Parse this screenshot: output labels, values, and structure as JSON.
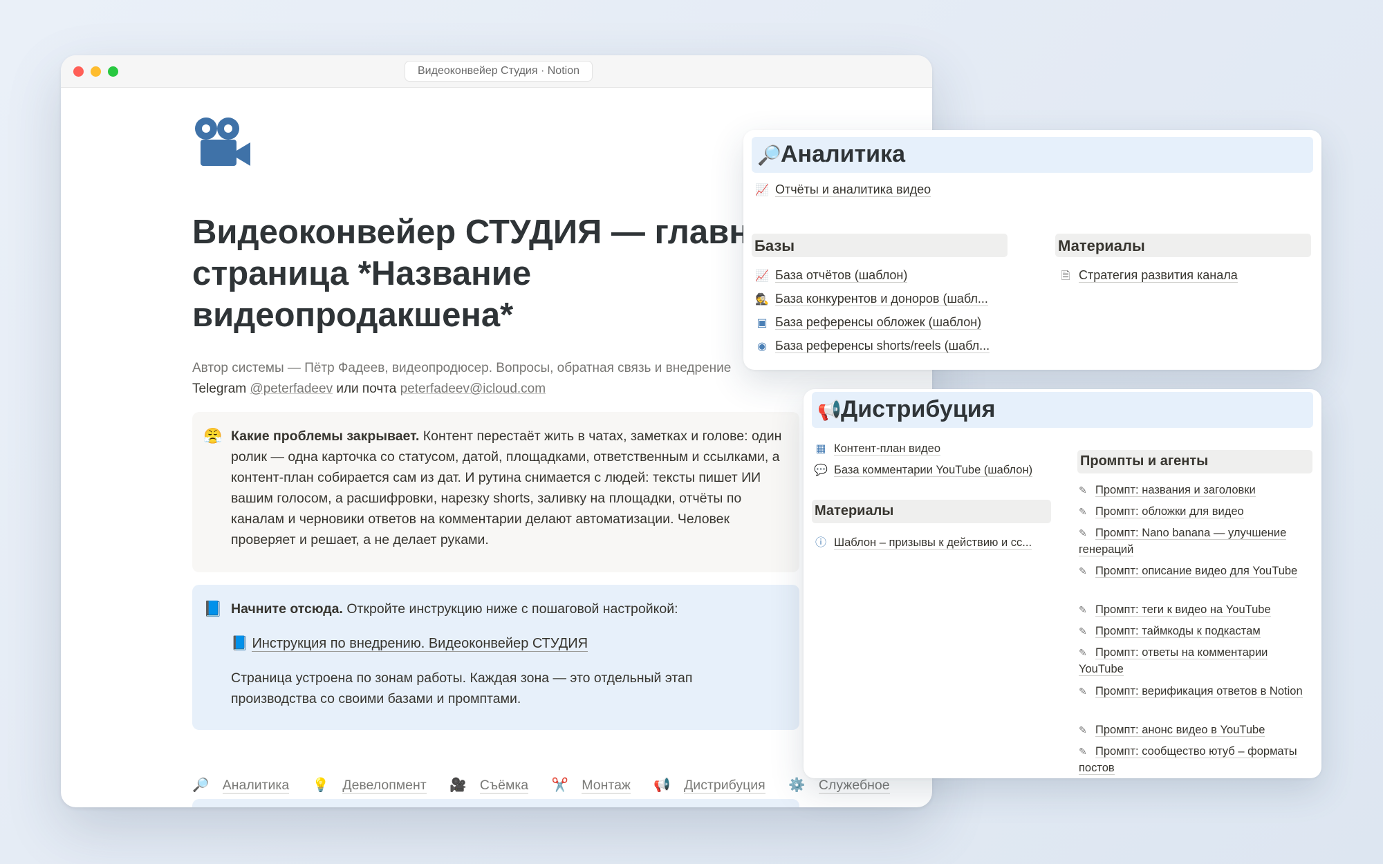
{
  "window": {
    "title": "Видеоконвейер Студия · Notion"
  },
  "page": {
    "icon": "video-camera-icon",
    "title": "Видеоконвейер СТУДИЯ — главн страница *Название видеопродакшена*",
    "author_line1": "Автор системы — Пётр Фадеев, видеопродюсер. Вопросы, обратная связь и внедрение",
    "author_telegram_prefix": "Telegram ",
    "author_telegram": "@peterfadeev",
    "author_or": " или почта ",
    "author_email": "peterfadeev@icloud.com",
    "callout1": {
      "icon": "😤",
      "bold": "Какие проблемы закрывает.",
      "text": " Контент перестаёт жить в чатах, заметках и голове: один ролик — одна карточка со статусом, датой, площадками, ответственным и ссылками, а контент-план собирается сам из дат. И рутина снимается с людей: тексты пишет ИИ вашим голосом, а расшифровки, нарезку shorts, заливку на площадки, отчёты по каналам и черновики ответов на комментарии делают автоматизации. Человек проверяет и решает, а не делает руками."
    },
    "callout2": {
      "icon": "📘",
      "bold": "Начните отсюда.",
      "text": " Откройте инструкцию ниже с пошаговой настройкой:",
      "link_icon": "📘",
      "link": "Инструкция по внедрению. Видеоконвейер СТУДИЯ",
      "desc": "Страница устроена по зонам работы. Каждая зона — это отдельный этап производства со своими базами и промптами."
    },
    "zones": [
      {
        "icon": "🔎",
        "label": "Аналитика"
      },
      {
        "icon": "💡",
        "label": "Девелопмент"
      },
      {
        "icon": "🎥",
        "label": "Съёмка"
      },
      {
        "icon": "✂️",
        "label": "Монтаж"
      },
      {
        "icon": "📢",
        "label": "Дистрибуция"
      },
      {
        "icon": "⚙️",
        "label": "Служебное"
      }
    ]
  },
  "analytics": {
    "icon": "🔎",
    "title": "Аналитика",
    "top_item": "Отчёты и аналитика видео",
    "bases_title": "Базы",
    "bases": [
      {
        "icon": "chart-icon",
        "label": "База отчётов (шаблон)"
      },
      {
        "icon": "spy-icon",
        "label": "База конкурентов и доноров (шабл..."
      },
      {
        "icon": "image-icon",
        "label": "База референсы обложек (шаблон)"
      },
      {
        "icon": "eye-icon",
        "label": "База референсы shorts/reels (шабл..."
      }
    ],
    "materials_title": "Материалы",
    "materials": [
      {
        "icon": "document-icon",
        "label": "Стратегия развития канала"
      }
    ]
  },
  "distribution": {
    "icon": "📢",
    "title": "Дистрибуция",
    "items": [
      {
        "icon": "calendar-icon",
        "label": "Контент-план видео"
      },
      {
        "icon": "comment-icon",
        "label": "База комментарии YouTube (шаблон)"
      }
    ],
    "materials_title": "Материалы",
    "materials": [
      {
        "icon": "info-icon",
        "label": "Шаблон – призывы к действию и сс..."
      }
    ],
    "prompts_title": "Промпты и агенты",
    "prompts": [
      "Промпт: названия и заголовки",
      "Промпт: обложки для видео",
      "Промпт: Nano banana — улучшение генераций",
      "Промпт: описание видео для YouTube",
      "Промпт: теги к видео на YouTube",
      "Промпт: таймкоды к подкастам",
      "Промпт: ответы на комментарии YouTube",
      "Промпт: верификация ответов в Notion",
      "Промпт: анонс видео в YouTube",
      "Промпт: сообщество ютуб – форматы постов"
    ]
  }
}
